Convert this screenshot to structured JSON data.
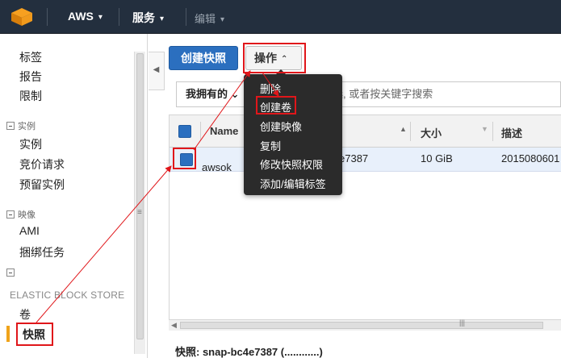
{
  "topbar": {
    "brand": "AWS",
    "services": "服务",
    "edit": "编辑",
    "caret": "▾",
    "logo_icon": "aws-cube-icon"
  },
  "sidebar": {
    "links_top": [
      "标签",
      "报告",
      "限制"
    ],
    "group_instances": "实例",
    "instances_items": [
      "实例",
      "竞价请求",
      "预留实例"
    ],
    "group_images": "映像",
    "images_items": [
      "AMI",
      "捆绑任务"
    ],
    "ebs_header": "ELASTIC BLOCK STORE",
    "ebs_items": [
      "卷",
      "快照"
    ],
    "active": "快照",
    "collapse_arrow": "◀",
    "scroll_grip": "≡"
  },
  "toolbar": {
    "create_snapshot": "创建快照",
    "actions": "操作",
    "actions_caret": "⌃"
  },
  "filter": {
    "owner": "我拥有的",
    "owner_caret": "⌄",
    "placeholder": "筛选, 或者按关键字搜索"
  },
  "table": {
    "columns": [
      "Name",
      "大小",
      "描述"
    ],
    "rows": [
      {
        "name": "awsok",
        "snapshot_id_fragment": "e7387",
        "size": "10 GiB",
        "description": "2015080601"
      }
    ]
  },
  "actions_menu": {
    "items": [
      "删除",
      "创建卷",
      "创建映像",
      "复制",
      "修改快照权限",
      "添加/编辑标签"
    ],
    "highlighted": "创建卷"
  },
  "detail": {
    "label": "快照: snap-bc4e7387 (............)"
  },
  "annotation": {
    "color": "#e0161a"
  }
}
